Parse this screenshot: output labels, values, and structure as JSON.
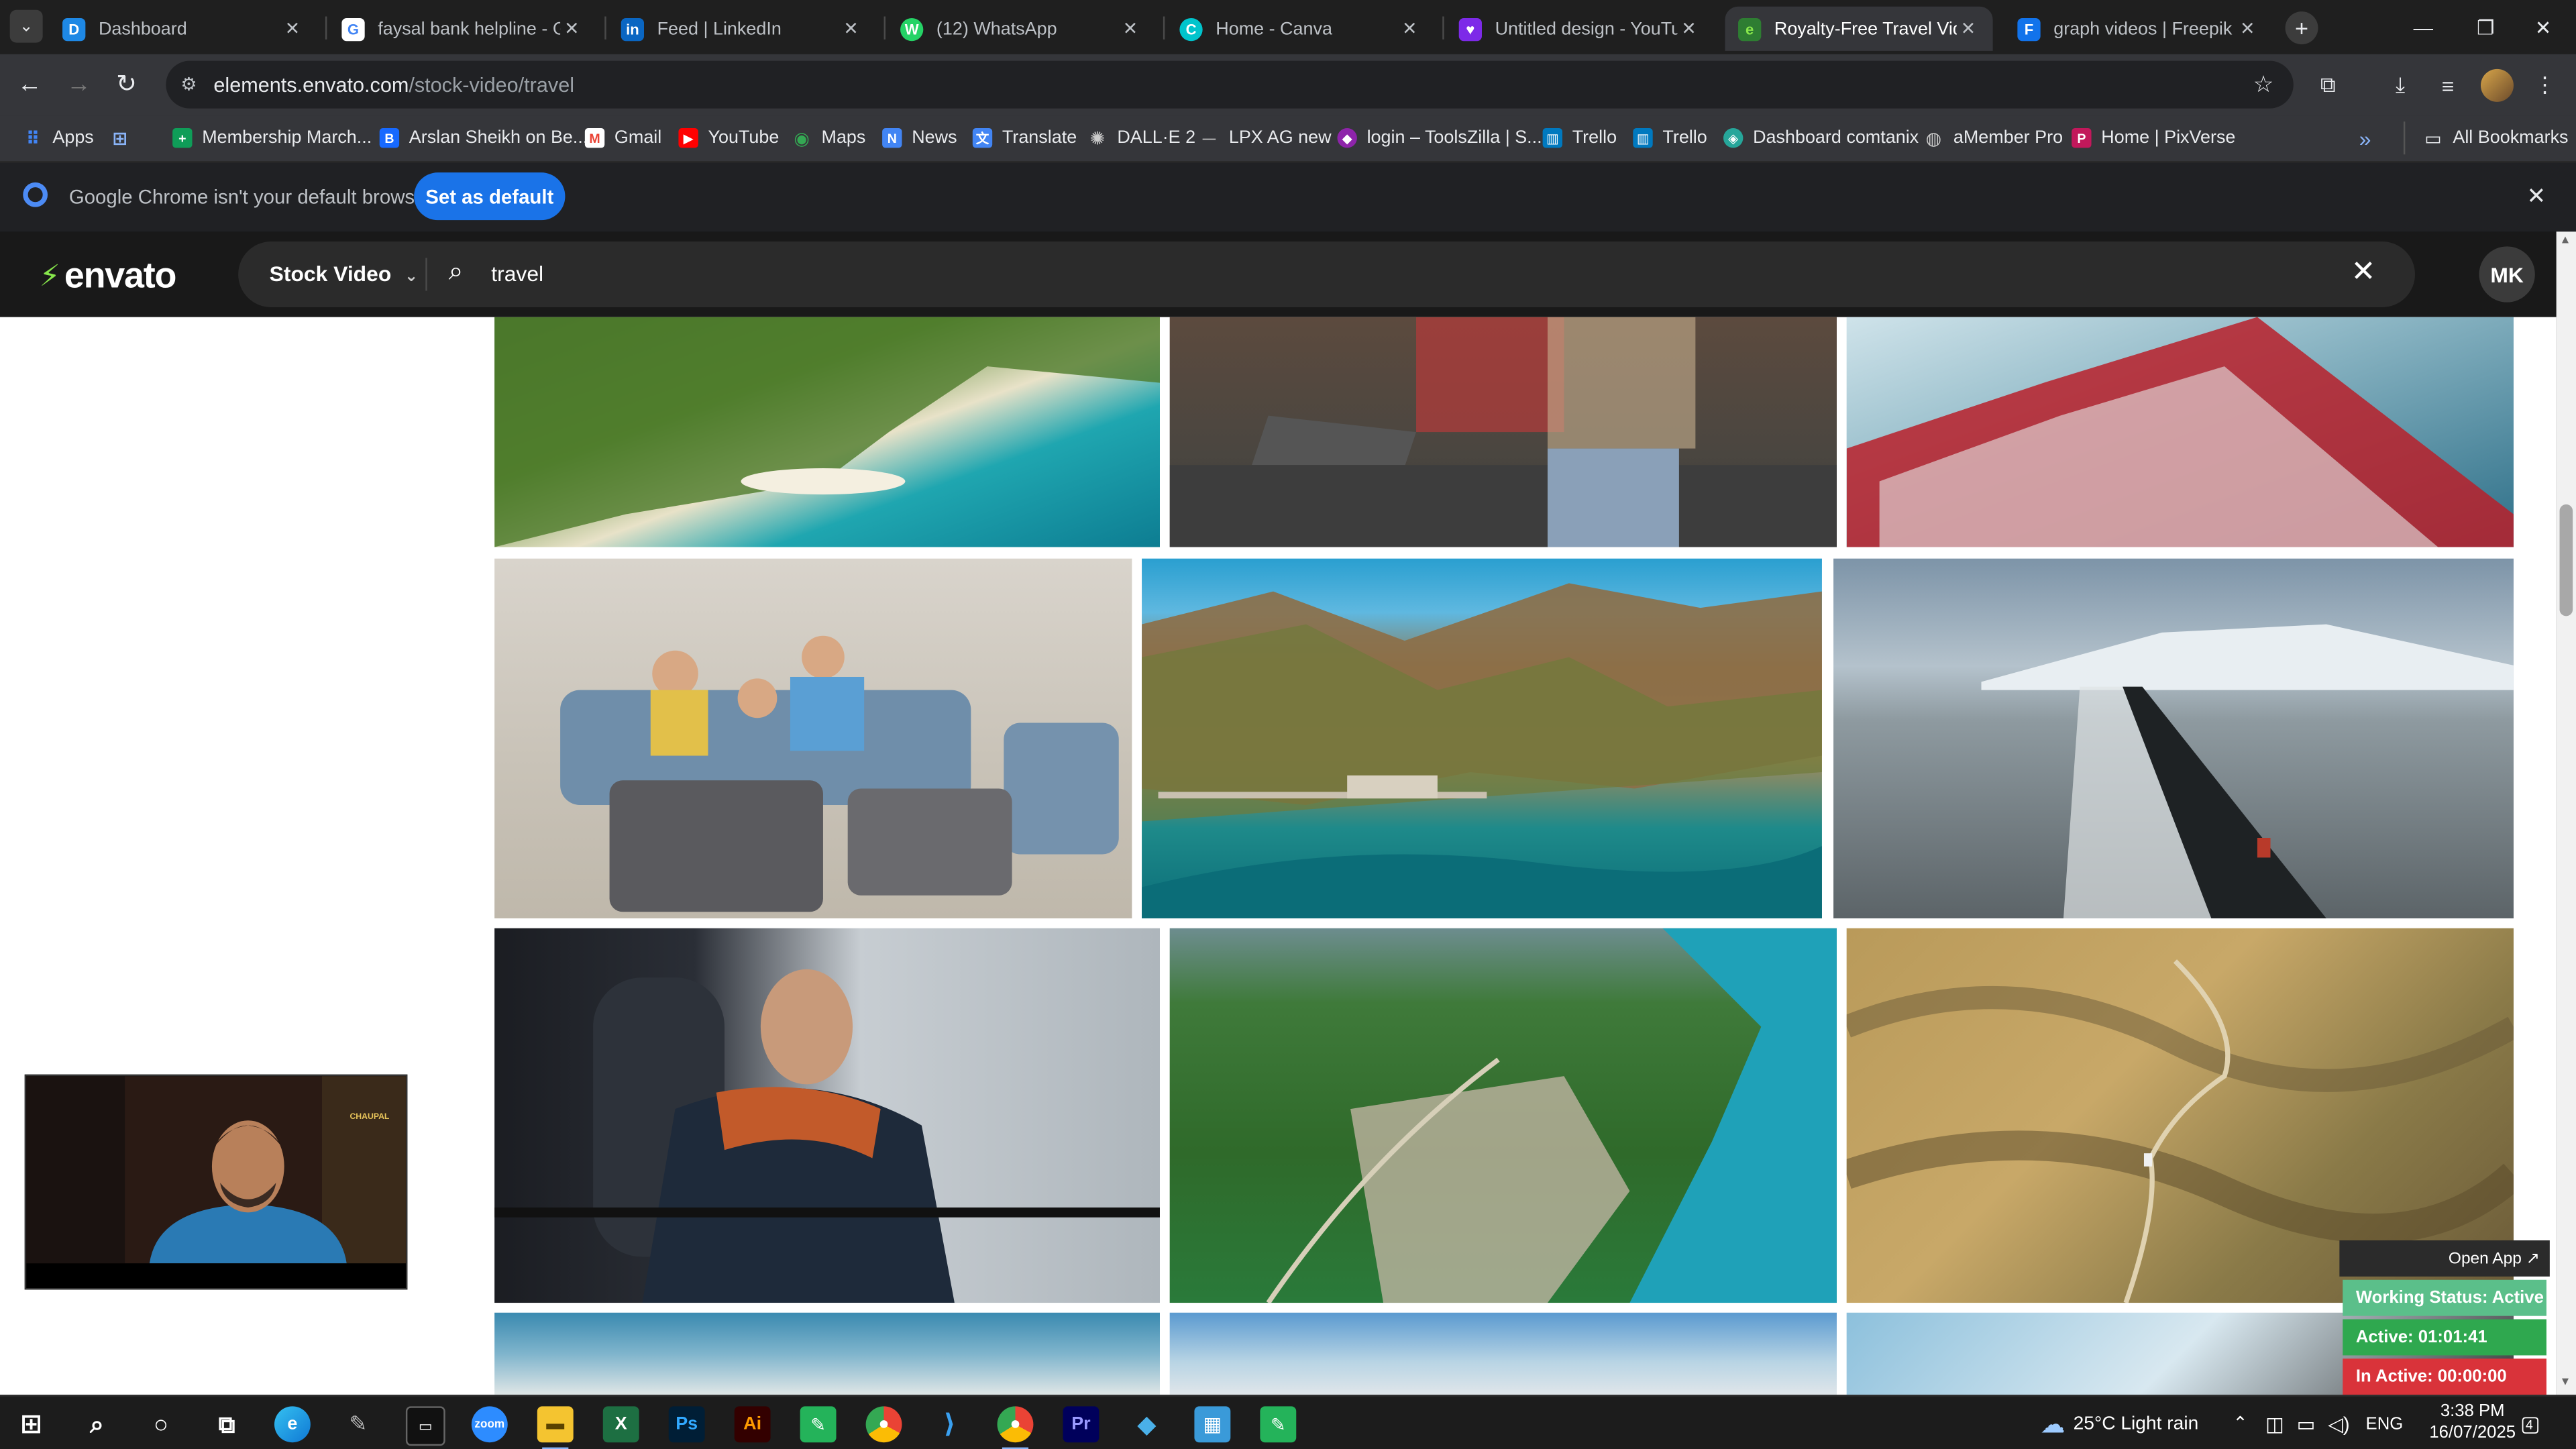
{
  "browser": {
    "tabs": [
      {
        "title": "Dashboard",
        "color": "#1e88e5",
        "glyph": "D"
      },
      {
        "title": "faysal bank helpline - Go",
        "color": "#ffffff",
        "glyph": "G"
      },
      {
        "title": "Feed | LinkedIn",
        "color": "#0a66c2",
        "glyph": "in"
      },
      {
        "title": "(12) WhatsApp",
        "color": "#25d366",
        "glyph": "W"
      },
      {
        "title": "Home - Canva",
        "color": "#00c4cc",
        "glyph": "C"
      },
      {
        "title": "Untitled design - YouTube",
        "color": "#7d2ae8",
        "glyph": "♥"
      },
      {
        "title": "Royalty-Free Travel Video",
        "color": "#87e64b",
        "glyph": "e"
      },
      {
        "title": "graph videos | Freepik",
        "color": "#1273eb",
        "glyph": "F"
      }
    ],
    "new_tab": "+",
    "url_host": "elements.envato.com",
    "url_path": "/stock-video/travel",
    "bookmarks": [
      {
        "label": "Apps",
        "color": "#4285f4"
      },
      {
        "label": "",
        "color": "#4a6fa5"
      },
      {
        "label": "Membership March...",
        "color": "#0f9d58"
      },
      {
        "label": "Arslan Sheikh on Be...",
        "color": "#1769ff"
      },
      {
        "label": "Gmail",
        "color": "#ea4335"
      },
      {
        "label": "YouTube",
        "color": "#ff0000"
      },
      {
        "label": "Maps",
        "color": "#34a853"
      },
      {
        "label": "News",
        "color": "#4285f4"
      },
      {
        "label": "Translate",
        "color": "#4285f4"
      },
      {
        "label": "DALL·E 2",
        "color": "#555555"
      },
      {
        "label": "LPX AG new",
        "color": "#444444"
      },
      {
        "label": "login – ToolsZilla | S...",
        "color": "#8e24aa"
      },
      {
        "label": "Trello",
        "color": "#0079bf"
      },
      {
        "label": "Trello",
        "color": "#0079bf"
      },
      {
        "label": "Dashboard comtanix",
        "color": "#26a69a"
      },
      {
        "label": "aMember Pro",
        "color": "#555555"
      },
      {
        "label": "Home | PixVerse",
        "color": "#c2185b"
      }
    ],
    "bookmarks_overflow": "»",
    "all_bookmarks": "All Bookmarks"
  },
  "infobar": {
    "message": "Google Chrome isn't your default browser",
    "button": "Set as default"
  },
  "envato": {
    "logo": "envato",
    "category": "Stock Video",
    "query": "travel",
    "avatar": "MK"
  },
  "pip": {
    "brand": "CHAUPAL"
  },
  "tracker": {
    "open_app": "Open App ↗",
    "working_status": "Working Status: Active",
    "active": "Active: 01:01:41",
    "inactive": "In Active: 00:00:00"
  },
  "taskbar": {
    "weather": "25°C  Light rain",
    "lang": "ENG",
    "time": "3:38 PM",
    "date": "16/07/2025",
    "notifications": "4"
  }
}
